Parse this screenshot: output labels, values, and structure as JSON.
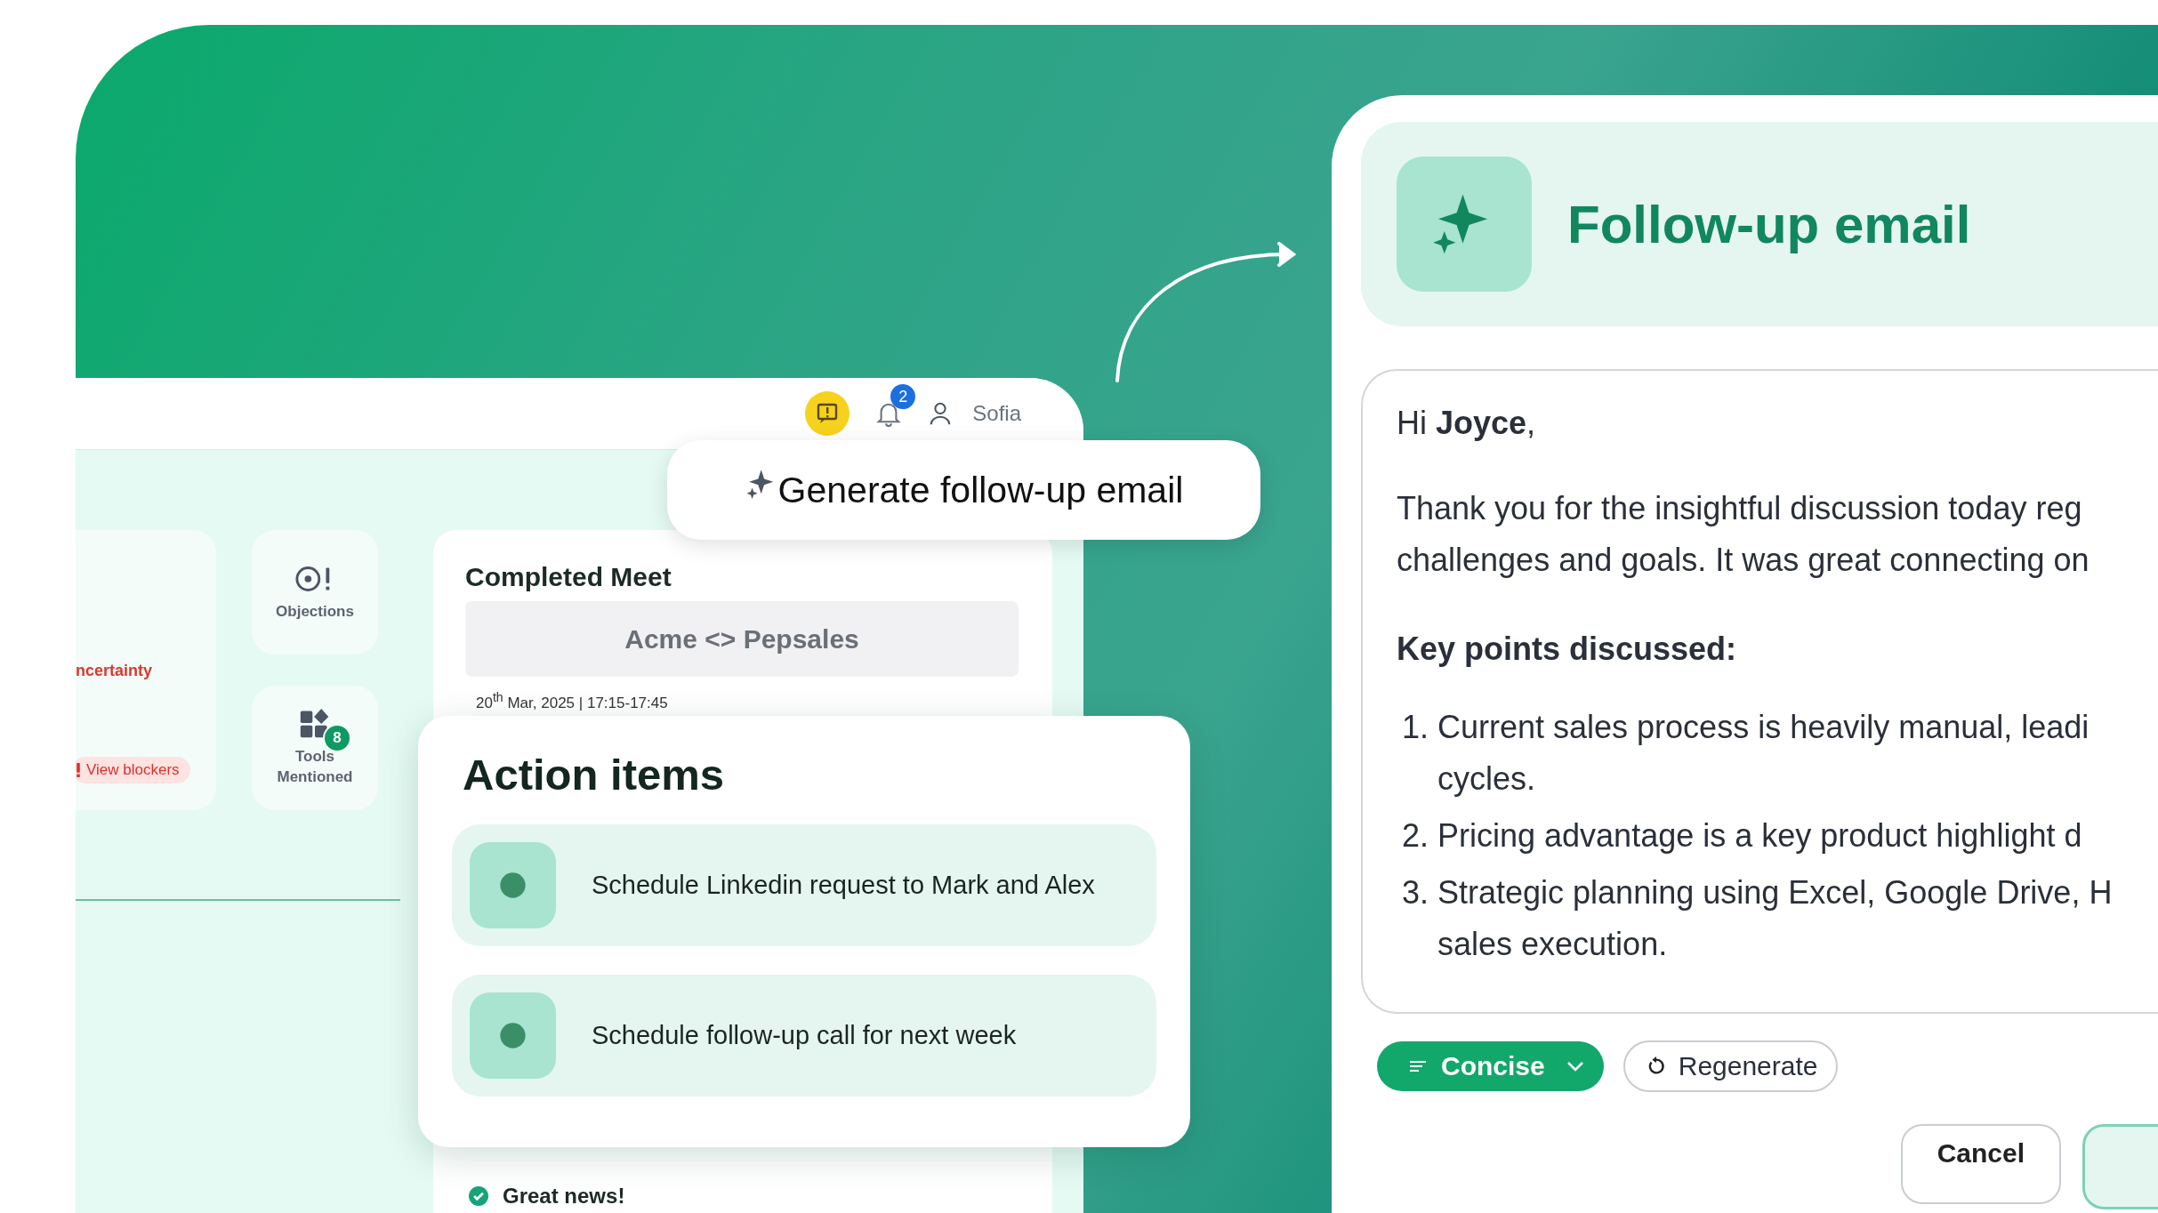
{
  "app": {
    "notifications": "2",
    "user": "Sofia",
    "left_card": {
      "label": "ncertainty",
      "link": "View blockers"
    },
    "tiles": [
      {
        "kind": "objections",
        "label": "Objections"
      },
      {
        "kind": "tools",
        "label": "Tools Mentioned",
        "badge": "8"
      }
    ]
  },
  "generate_button": {
    "label": "Generate follow-up email"
  },
  "meeting": {
    "status": "Completed Meet",
    "title": "Acme <> Pepsales",
    "date": "20$^{th}$ Mar, 2025 | 17:15-17:45"
  },
  "action_items": {
    "title": "Action items",
    "items": [
      {
        "label": "Schedule Linkedin request to Mark and Alex"
      },
      {
        "label": "Schedule follow-up call for next week"
      }
    ]
  },
  "note": {
    "label": "Great news!"
  },
  "email_panel": {
    "title": "Follow-up email",
    "greeting": "Hi **Joyce**,",
    "body_lines": [
      "Thank you for the insightful discussion today reg",
      "challenges and goals. It was great connecting on"
    ],
    "heading": "Key points discussed:",
    "points": [
      {
        "number": "1.",
        "lines": [
          "Current sales process is heavily manual, leadi",
          "cycles."
        ]
      },
      {
        "number": "2.",
        "lines": [
          "Pricing advantage is a key product highlight d"
        ]
      },
      {
        "number": "3.",
        "lines": [
          "Strategic planning using Excel, Google Drive, H",
          "sales execution."
        ]
      }
    ],
    "tone": "Concise",
    "regenerate": "Regenerate",
    "cancel": "Cancel"
  }
}
